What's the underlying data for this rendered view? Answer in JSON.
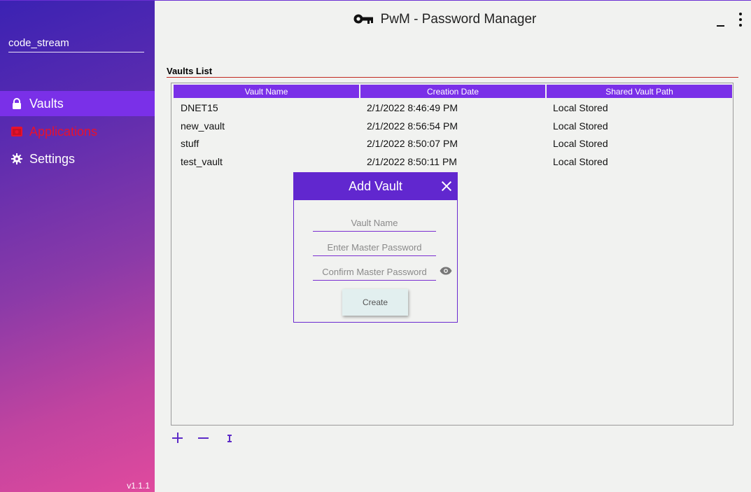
{
  "app": {
    "title": "PwM - Password Manager",
    "version": "v1.1.1"
  },
  "sidebar": {
    "user": "code_stream",
    "items": [
      {
        "label": "Vaults",
        "icon": "lock-icon"
      },
      {
        "label": "Applications",
        "icon": "app-window-icon"
      },
      {
        "label": "Settings",
        "icon": "gear-icon"
      }
    ]
  },
  "vaults": {
    "title": "Vaults List",
    "columns": [
      "Vault Name",
      "Creation Date",
      "Shared Vault Path"
    ],
    "rows": [
      [
        "DNET15",
        "2/1/2022 8:46:49 PM",
        "Local Stored"
      ],
      [
        "new_vault",
        "2/1/2022 8:56:54 PM",
        "Local Stored"
      ],
      [
        "stuff",
        "2/1/2022 8:50:07 PM",
        "Local Stored"
      ],
      [
        "test_vault",
        "2/1/2022 8:50:11 PM",
        "Local Stored"
      ]
    ]
  },
  "dialog": {
    "title": "Add Vault",
    "vault_name_placeholder": "Vault Name",
    "password_placeholder": "Enter Master Password",
    "confirm_placeholder": "Confirm Master Password",
    "create_label": "Create"
  },
  "colors": {
    "accent": "#7a30e8",
    "dialog_header": "#6127cf",
    "applications_text": "#e8112d"
  }
}
